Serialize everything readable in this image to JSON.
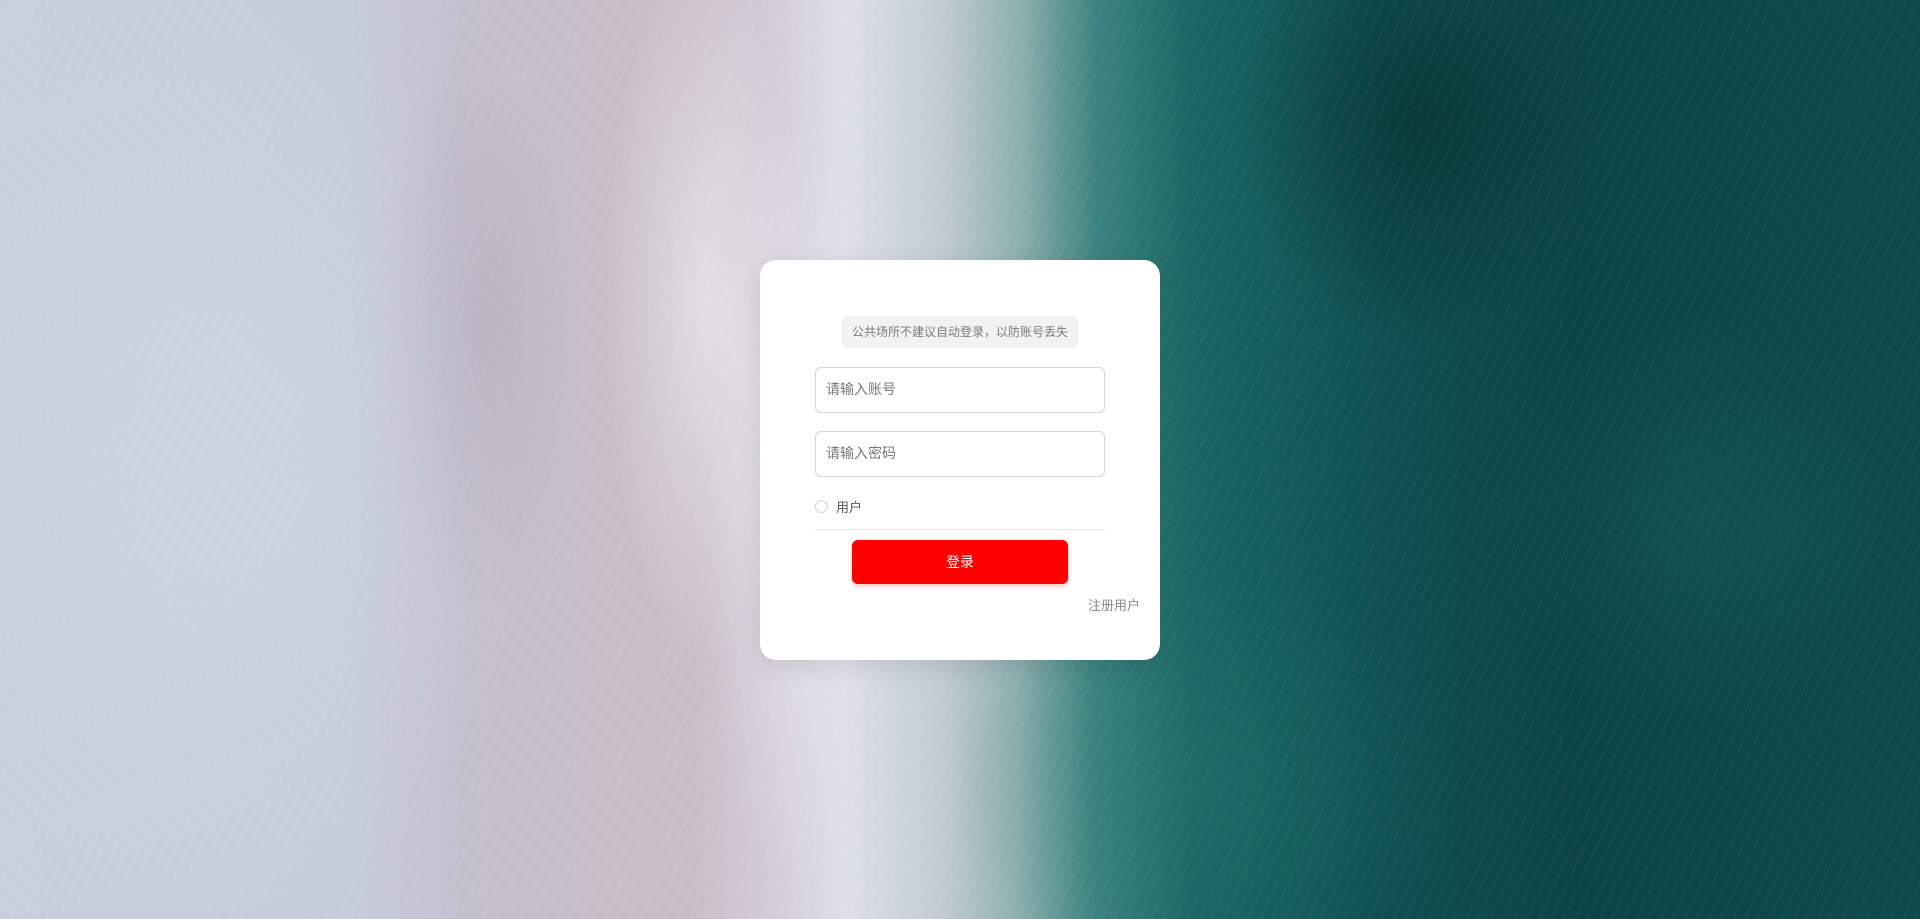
{
  "login": {
    "notice": "公共场所不建议自动登录，以防账号丢失",
    "account_placeholder": "请输入账号",
    "password_placeholder": "请输入密码",
    "role_label": "用户",
    "role_selected": false,
    "login_button": "登录",
    "register_link": "注册用户"
  },
  "colors": {
    "primary_button": "#ff0000",
    "card_background": "#ffffff"
  }
}
